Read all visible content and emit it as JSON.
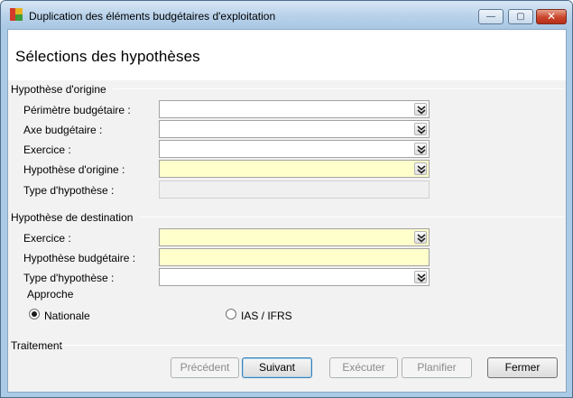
{
  "window": {
    "title": "Duplication des éléments budgétaires d'exploitation",
    "min_glyph": "—",
    "max_glyph": "▢",
    "close_glyph": "✕"
  },
  "page": {
    "title": "Sélections des hypothèses"
  },
  "origin": {
    "group_label": "Hypothèse d'origine",
    "fields": [
      {
        "label": "Périmètre budgétaire :",
        "value": "",
        "kind": "combo"
      },
      {
        "label": "Axe budgétaire :",
        "value": "",
        "kind": "combo"
      },
      {
        "label": "Exercice :",
        "value": "",
        "kind": "combo"
      },
      {
        "label": "Hypothèse d'origine :",
        "value": "",
        "kind": "combo-required"
      },
      {
        "label": "Type d'hypothèse :",
        "value": "",
        "kind": "readonly"
      }
    ]
  },
  "destination": {
    "group_label": "Hypothèse de destination",
    "fields": [
      {
        "label": "Exercice :",
        "value": "",
        "kind": "combo-required"
      },
      {
        "label": "Hypothèse budgétaire :",
        "value": "",
        "kind": "text-required"
      },
      {
        "label": "Type d'hypothèse :",
        "value": "",
        "kind": "combo"
      }
    ],
    "approche_label": "Approche",
    "radios": [
      {
        "label": "Nationale",
        "checked": true
      },
      {
        "label": "IAS / IFRS",
        "checked": false
      }
    ]
  },
  "treatment": {
    "group_label": "Traitement"
  },
  "buttons": {
    "previous": "Précédent",
    "next": "Suivant",
    "execute": "Exécuter",
    "schedule": "Planifier",
    "close": "Fermer"
  },
  "colors": {
    "required_field": "#ffffcc",
    "title_bar": "#b9d2ea",
    "close_button": "#c9452b"
  }
}
